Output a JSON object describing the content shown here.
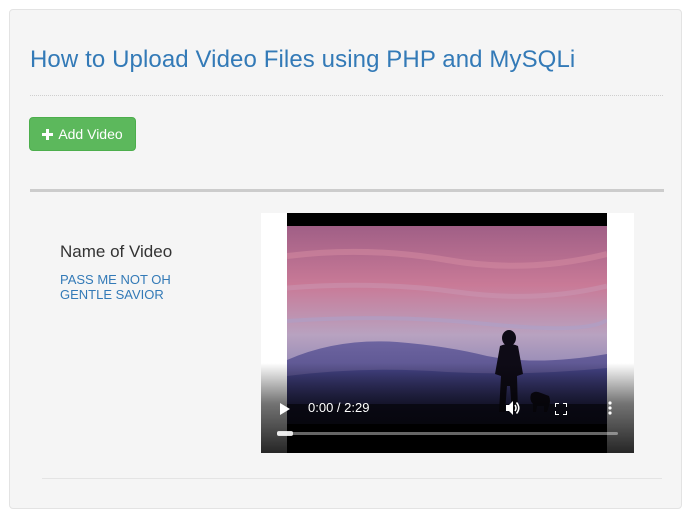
{
  "page": {
    "title": "How to Upload Video Files using PHP and MySQLi",
    "add_button_label": "Add Video"
  },
  "video_item": {
    "name_label": "Name of Video",
    "name_value": "PASS ME NOT OH GENTLE SAVIOR"
  },
  "player": {
    "current_time": "0:00",
    "duration": "2:29",
    "time_display": "0:00 / 2:29",
    "progress": 0.0
  },
  "icons": {
    "add": "plus-icon",
    "play": "play-icon",
    "volume": "volume-icon",
    "fullscreen": "fullscreen-icon",
    "more": "more-vertical-icon"
  },
  "colors": {
    "title": "#337ab7",
    "success_button": "#5cb85c",
    "link_text": "#337ab7",
    "well_background": "#f5f5f5"
  }
}
